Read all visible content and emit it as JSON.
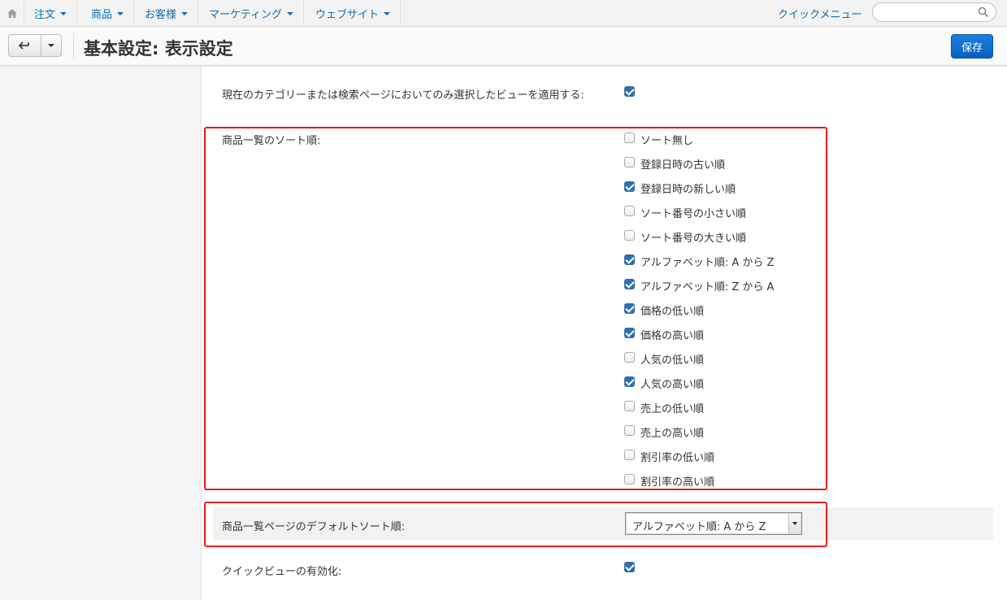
{
  "nav": {
    "home_icon": "home-icon",
    "menus": [
      "注文",
      "商品",
      "お客様",
      "マーケティング",
      "ウェブサイト"
    ],
    "quick_menu": "クイックメニュー",
    "search_placeholder": "",
    "search_icon": "search-icon"
  },
  "header": {
    "back_icon": "back-arrow-icon",
    "title": "基本設定: 表示設定",
    "save_label": "保存"
  },
  "settings": {
    "apply_view_label": "現在のカテゴリーまたは検索ページにおいてのみ選択したビューを適用する:",
    "apply_view_checked": true,
    "sort_label": "商品一覧のソート順:",
    "sort_options": [
      {
        "label": "ソート無し",
        "checked": false
      },
      {
        "label": "登録日時の古い順",
        "checked": false
      },
      {
        "label": "登録日時の新しい順",
        "checked": true
      },
      {
        "label": "ソート番号の小さい順",
        "checked": false
      },
      {
        "label": "ソート番号の大きい順",
        "checked": false
      },
      {
        "label": "アルファベット順: A から Z",
        "checked": true
      },
      {
        "label": "アルファベット順: Z から A",
        "checked": true
      },
      {
        "label": "価格の低い順",
        "checked": true
      },
      {
        "label": "価格の高い順",
        "checked": true
      },
      {
        "label": "人気の低い順",
        "checked": false
      },
      {
        "label": "人気の高い順",
        "checked": true
      },
      {
        "label": "売上の低い順",
        "checked": false
      },
      {
        "label": "売上の高い順",
        "checked": false
      },
      {
        "label": "割引率の低い順",
        "checked": false
      },
      {
        "label": "割引率の高い順",
        "checked": false
      }
    ],
    "default_sort_label": "商品一覧ページのデフォルトソート順:",
    "default_sort_value": "アルファベット順: A から Z",
    "quick_view_label": "クイックビューの有効化:",
    "quick_view_checked": true
  },
  "colors": {
    "link": "#0b6cb6",
    "primary_button": "#0b5fbf",
    "highlight_box": "#e31c1c"
  }
}
